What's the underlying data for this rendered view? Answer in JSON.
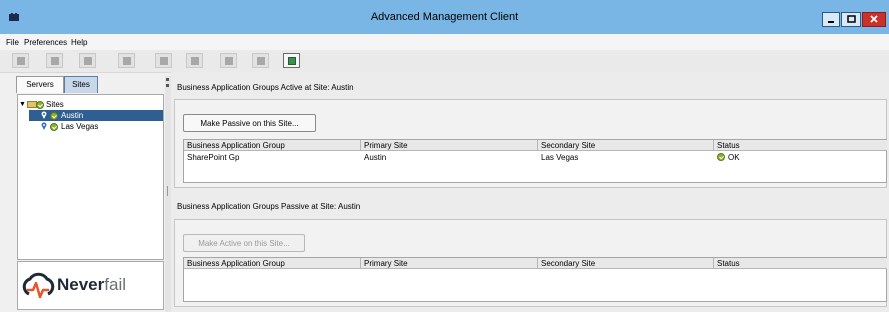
{
  "window": {
    "title": "Advanced Management Client"
  },
  "menu": {
    "items": [
      "File",
      "Preferences",
      "Help"
    ]
  },
  "toolbar": {
    "buttons": [
      "tool-1-icon",
      "tool-2-icon",
      "tool-3-icon",
      "tool-4-icon",
      "tool-5-icon",
      "tool-6-icon",
      "tool-7-icon",
      "tool-8-icon",
      "tool-9-icon"
    ],
    "active_index": 8
  },
  "left": {
    "tabs": [
      "Servers",
      "Sites"
    ],
    "tree": [
      {
        "label": "Sites",
        "level": 0
      },
      {
        "label": "Austin",
        "level": 1,
        "selected": true
      },
      {
        "label": "Las Vegas",
        "level": 1
      }
    ],
    "logo": {
      "brand_bold": "Never",
      "brand_light": "fail"
    }
  },
  "active_section": {
    "title": "Business Application Groups Active at Site: Austin",
    "button": "Make Passive on this Site...",
    "columns": [
      "Business Application Group",
      "Primary Site",
      "Secondary Site",
      "Status"
    ],
    "rows": [
      {
        "group": "SharePoint Gp",
        "primary": "Austin",
        "secondary": "Las Vegas",
        "status": "OK"
      }
    ]
  },
  "passive_section": {
    "title": "Business Application Groups Passive at Site: Austin",
    "button": "Make Active on this Site...",
    "columns": [
      "Business Application Group",
      "Primary Site",
      "Secondary Site",
      "Status"
    ],
    "rows": []
  },
  "colors": {
    "titlebar": "#7ab6e5",
    "selection": "#2f5f92",
    "ok_green": "#8bb02e",
    "close": "#c9322a"
  }
}
